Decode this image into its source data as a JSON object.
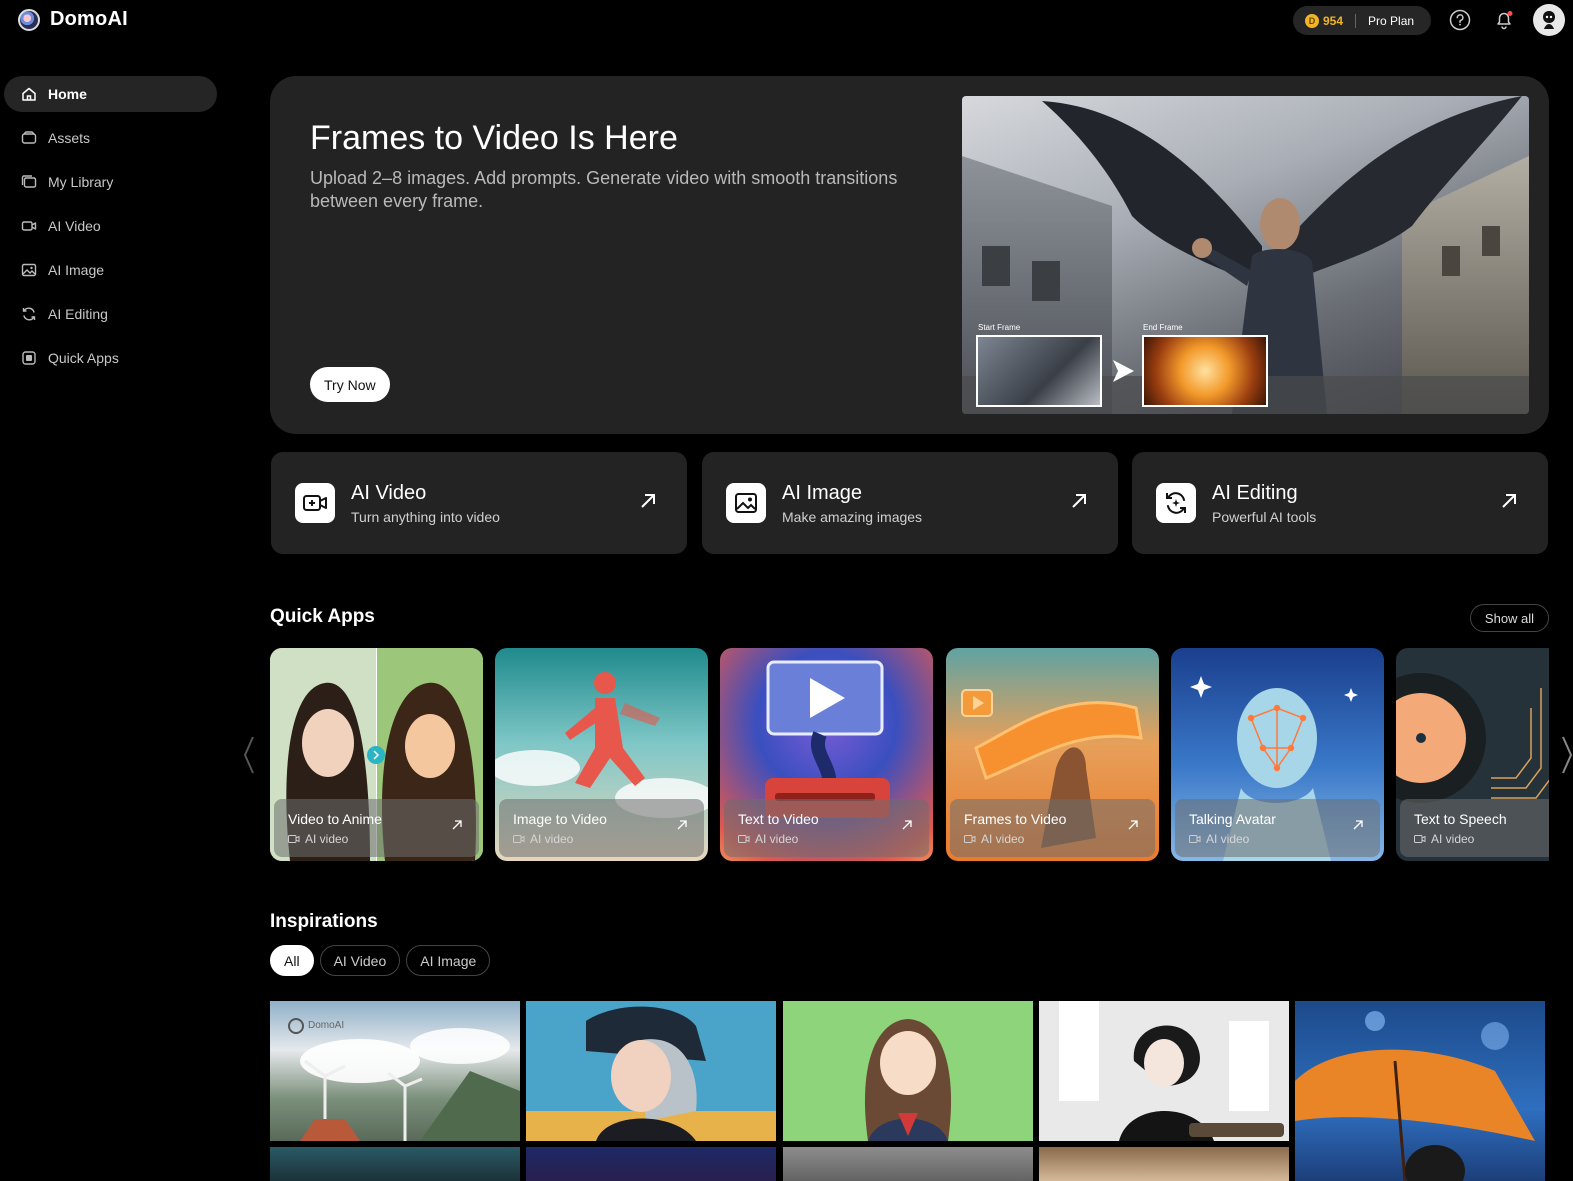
{
  "app": {
    "name": "DomoAI"
  },
  "header": {
    "credits": "954",
    "plan": "Pro Plan"
  },
  "sidebar": {
    "items": [
      {
        "label": "Home",
        "icon": "home-icon",
        "active": true
      },
      {
        "label": "Assets",
        "icon": "assets-icon"
      },
      {
        "label": "My Library",
        "icon": "library-icon"
      },
      {
        "label": "AI Video",
        "icon": "video-icon"
      },
      {
        "label": "AI Image",
        "icon": "image-icon"
      },
      {
        "label": "AI Editing",
        "icon": "editing-icon"
      },
      {
        "label": "Quick Apps",
        "icon": "quick-apps-icon"
      }
    ]
  },
  "hero": {
    "title": "Frames to Video Is Here",
    "subtitle": "Upload 2–8 images. Add prompts. Generate video with smooth transitions between every frame.",
    "cta": "Try Now",
    "start_frame_label": "Start Frame",
    "end_frame_label": "End Frame"
  },
  "features": [
    {
      "title": "AI Video",
      "subtitle": "Turn anything into video",
      "icon": "video-camera-icon"
    },
    {
      "title": "AI Image",
      "subtitle": "Make amazing images",
      "icon": "image-icon"
    },
    {
      "title": "AI Editing",
      "subtitle": "Powerful AI tools",
      "icon": "editing-icon"
    }
  ],
  "quick_apps": {
    "title": "Quick Apps",
    "show_all": "Show all",
    "items": [
      {
        "name": "Video to Anime",
        "type": "AI video"
      },
      {
        "name": "Image to Video",
        "type": "AI video"
      },
      {
        "name": "Text to Video",
        "type": "AI video"
      },
      {
        "name": "Frames to Video",
        "type": "AI video"
      },
      {
        "name": "Talking Avatar",
        "type": "AI video"
      },
      {
        "name": "Text to Speech",
        "type": "AI video"
      }
    ]
  },
  "inspirations": {
    "title": "Inspirations",
    "filters": [
      {
        "label": "All",
        "active": true
      },
      {
        "label": "AI Video"
      },
      {
        "label": "AI Image"
      }
    ],
    "watermark": "DomoAI"
  },
  "colors": {
    "background": "#000000",
    "card": "#232323",
    "accent_coin": "#f0b429"
  }
}
